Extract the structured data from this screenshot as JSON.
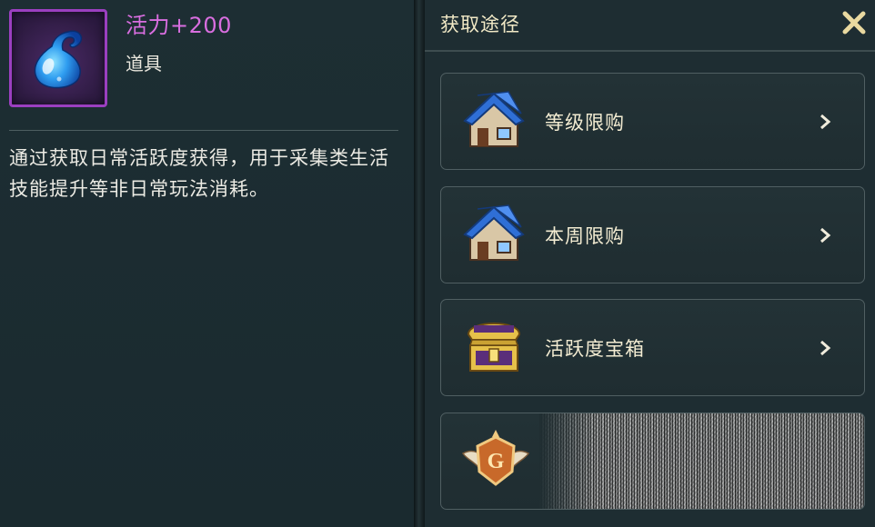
{
  "item": {
    "name": "活力+200",
    "type": "道具",
    "description": "通过获取日常活跃度获得，用于采集类生活技能提升等非日常玩法消耗。",
    "icon": "blue-droplet-icon"
  },
  "sources_panel": {
    "title": "获取途径",
    "close_icon": "close-icon",
    "items": [
      {
        "label": "等级限购",
        "icon": "shop-house-icon"
      },
      {
        "label": "本周限购",
        "icon": "shop-house-icon"
      },
      {
        "label": "活跃度宝箱",
        "icon": "treasure-chest-icon"
      },
      {
        "label": "",
        "icon": "guild-emblem-icon"
      }
    ]
  },
  "colors": {
    "item_name": "#d96ee0",
    "rarity_frame": "#9b3fc0",
    "close_icon": "#e9d9a0",
    "panel_bg": "#1e2d32"
  }
}
